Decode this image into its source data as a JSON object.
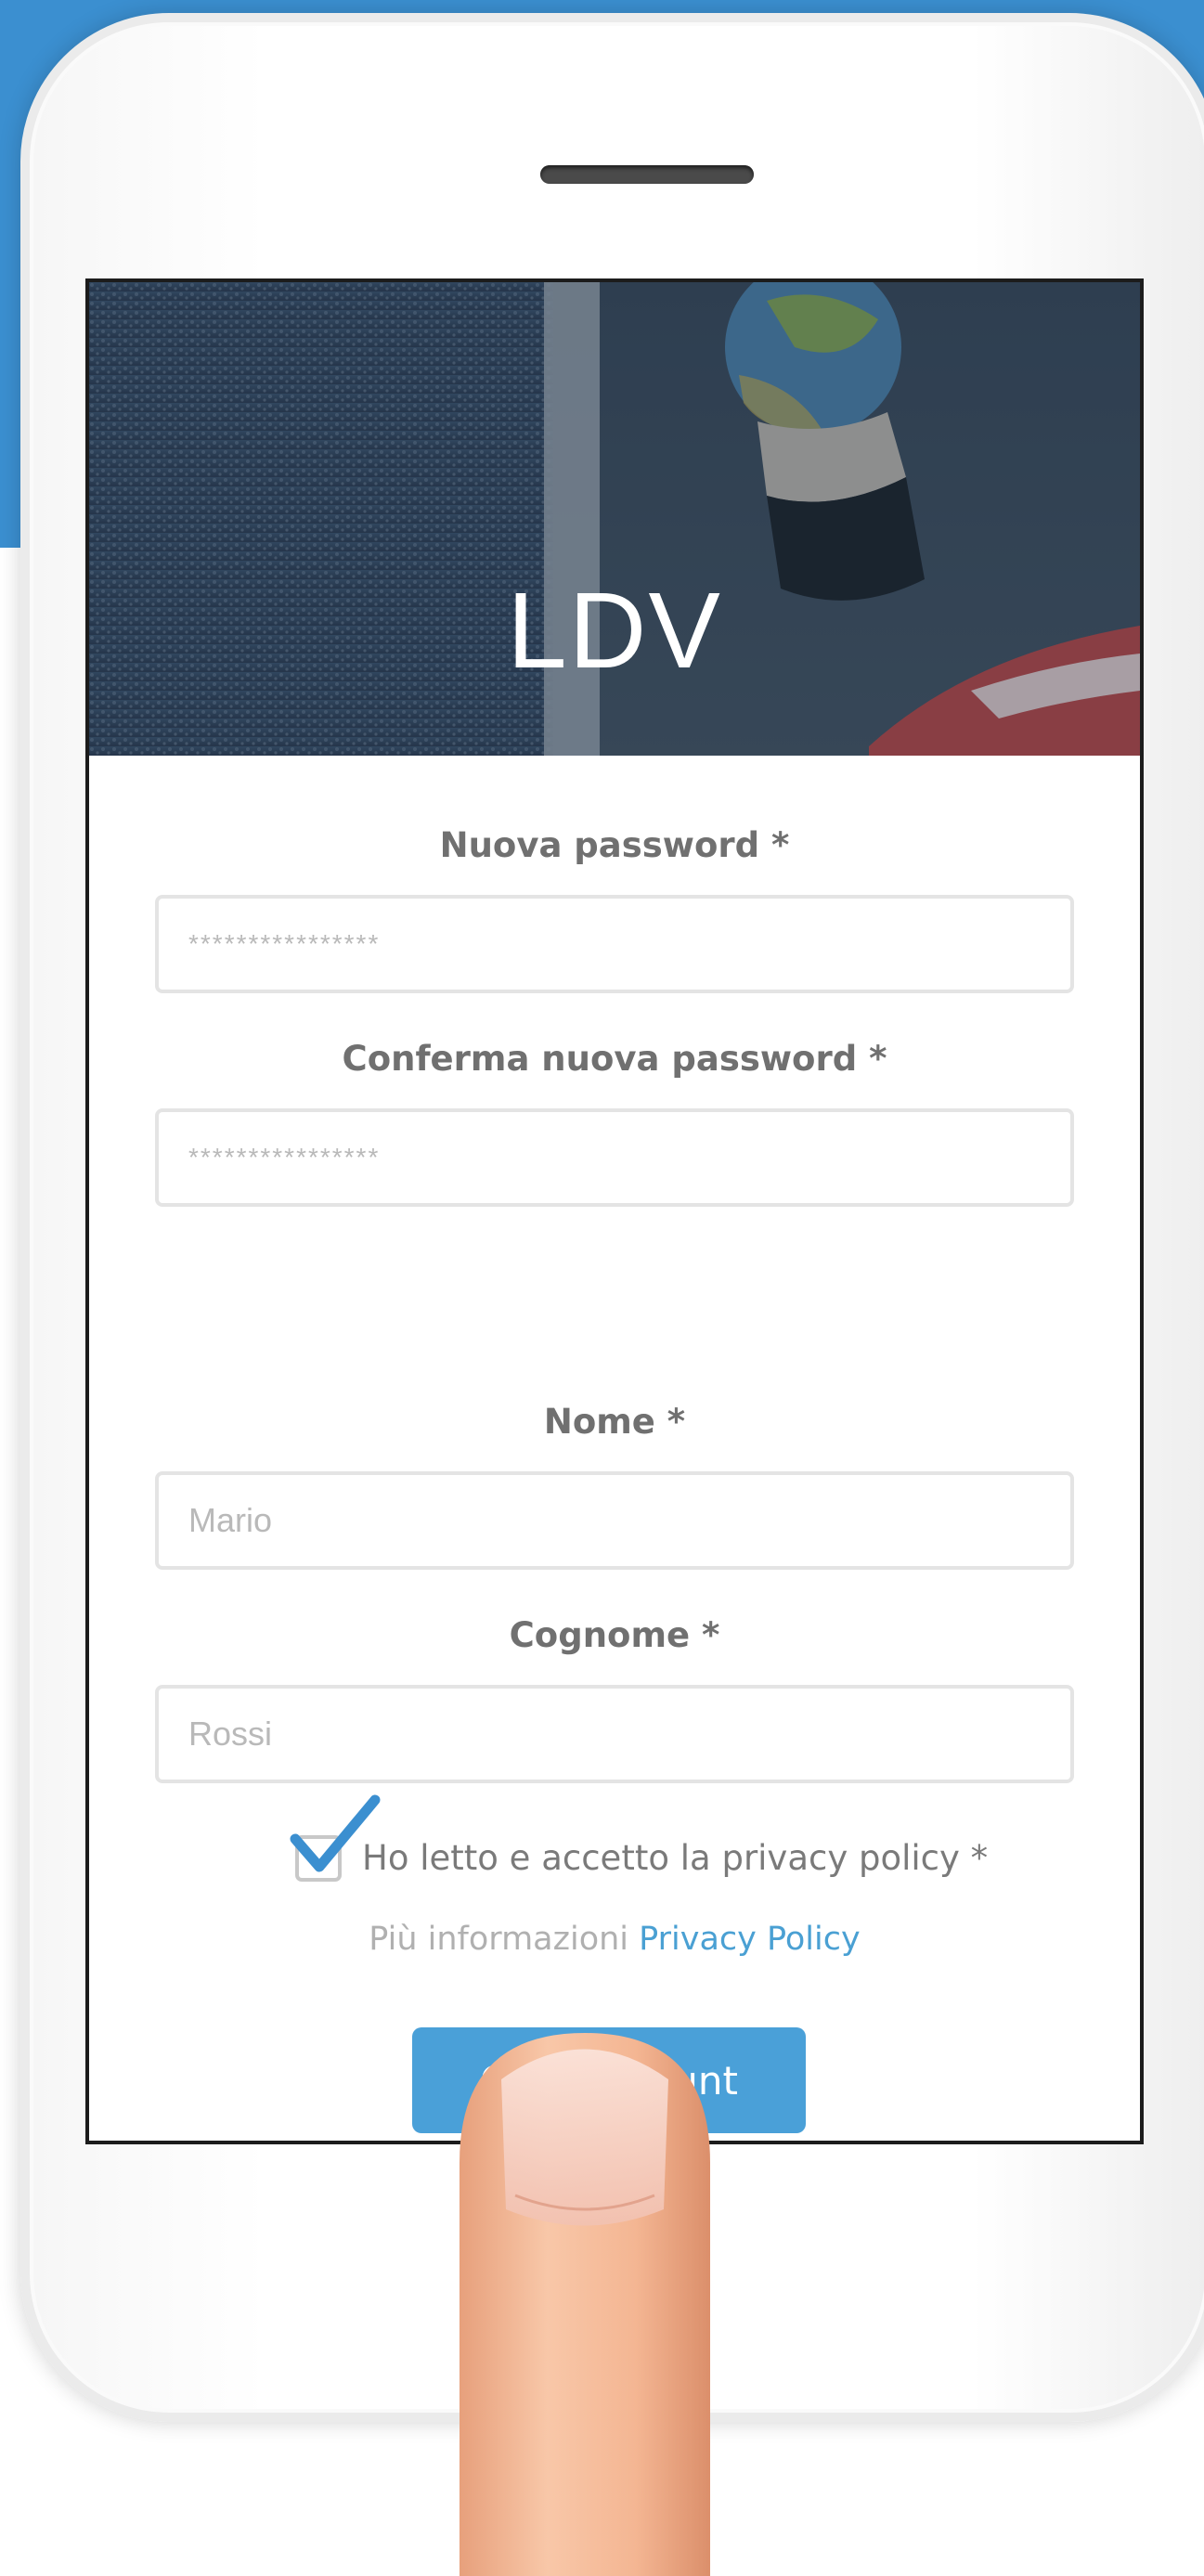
{
  "colors": {
    "brand_blue": "#3b8fd0",
    "button_blue": "#4aa0d8",
    "link_blue": "#4aa0d3",
    "label_gray": "#707070",
    "placeholder_gray": "#b9b9b9"
  },
  "header": {
    "title": "LDV"
  },
  "form": {
    "new_password": {
      "label": "Nuova password *",
      "placeholder": "****************"
    },
    "confirm_password": {
      "label": "Conferma nuova password *",
      "placeholder": "****************"
    },
    "first_name": {
      "label": "Nome *",
      "placeholder": "Mario"
    },
    "last_name": {
      "label": "Cognome *",
      "placeholder": "Rossi"
    },
    "privacy": {
      "checked": true,
      "label": "Ho letto e accetto la privacy policy *",
      "more_info_text": "Più informazioni",
      "link_text": "Privacy Policy"
    },
    "submit": {
      "label": "Crea account"
    }
  },
  "icons": {
    "checkbox_mark": "check-icon"
  }
}
